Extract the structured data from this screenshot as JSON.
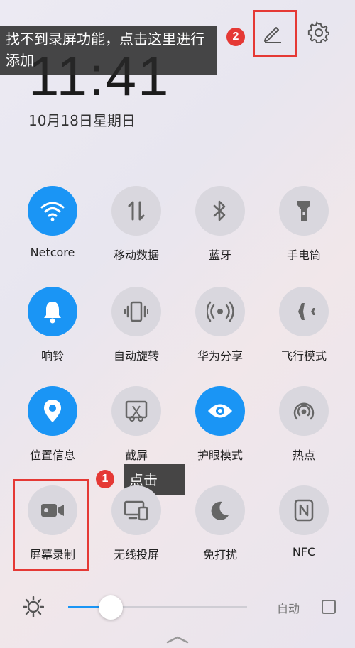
{
  "annotations": {
    "top_tooltip": "找不到录屏功能，点击这里进行添加",
    "top_badge": "2",
    "bottom_tooltip": "点击",
    "bottom_badge": "1"
  },
  "header": {
    "time": "11:41",
    "date": "10月18日星期日",
    "edit_icon": "pencil-icon",
    "settings_icon": "gear-icon"
  },
  "tiles": [
    {
      "label": "Netcore",
      "icon": "wifi-icon",
      "active": true
    },
    {
      "label": "移动数据",
      "icon": "mobile-data-icon",
      "active": false
    },
    {
      "label": "蓝牙",
      "icon": "bluetooth-icon",
      "active": false
    },
    {
      "label": "手电筒",
      "icon": "flashlight-icon",
      "active": false
    },
    {
      "label": "响铃",
      "icon": "bell-icon",
      "active": true
    },
    {
      "label": "自动旋转",
      "icon": "auto-rotate-icon",
      "active": false
    },
    {
      "label": "华为分享",
      "icon": "huawei-share-icon",
      "active": false
    },
    {
      "label": "飞行模式",
      "icon": "airplane-icon",
      "active": false
    },
    {
      "label": "位置信息",
      "icon": "location-icon",
      "active": true
    },
    {
      "label": "截屏",
      "icon": "screenshot-icon",
      "active": false
    },
    {
      "label": "护眼模式",
      "icon": "eye-icon",
      "active": true
    },
    {
      "label": "热点",
      "icon": "hotspot-icon",
      "active": false
    },
    {
      "label": "屏幕录制",
      "icon": "screen-record-icon",
      "active": false
    },
    {
      "label": "无线投屏",
      "icon": "wireless-projection-icon",
      "active": false
    },
    {
      "label": "免打扰",
      "icon": "moon-icon",
      "active": false
    },
    {
      "label": "NFC",
      "icon": "nfc-icon",
      "active": false
    }
  ],
  "brightness": {
    "level": 0.24,
    "auto_label": "自动",
    "auto_checked": false,
    "sun_icon": "brightness-sun-icon"
  },
  "colors": {
    "accent": "#1a95f5",
    "annotation_red": "#e53935",
    "tile_inactive": "#d9d7de"
  }
}
